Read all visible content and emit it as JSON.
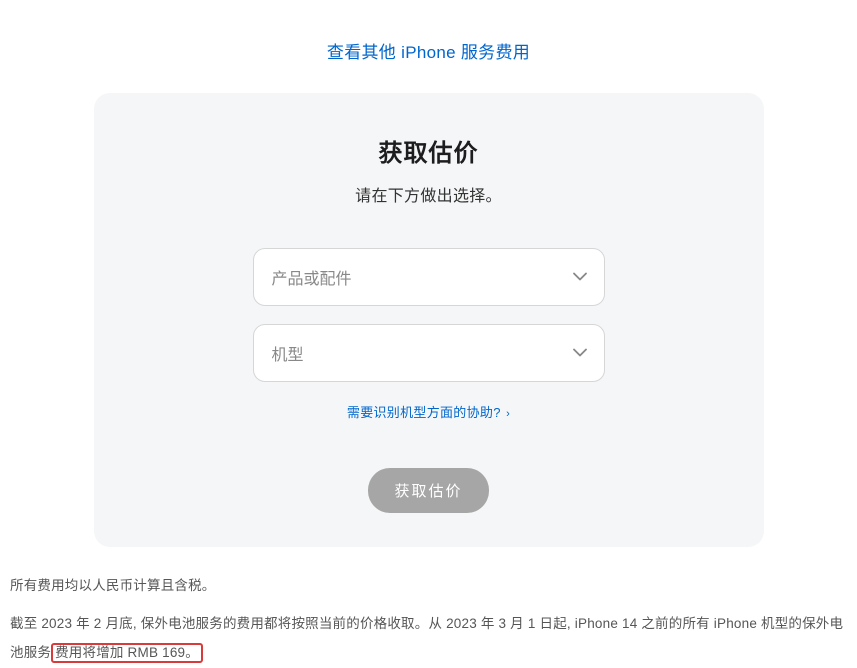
{
  "top_link": "查看其他 iPhone 服务费用",
  "card": {
    "title": "获取估价",
    "subtitle": "请在下方做出选择。",
    "select_product_placeholder": "产品或配件",
    "select_model_placeholder": "机型",
    "help_link": "需要识别机型方面的协助?",
    "submit": "获取估价"
  },
  "footer": {
    "note1": "所有费用均以人民币计算且含税。",
    "note2_part1": "截至 2023 年 2 月底, 保外电池服务的费用都将按照当前的价格收取。从 2023 年 3 月 1 日起, iPhone 14 之前的所有 iPhone 机型的保外电池服务",
    "note2_highlight": "费用将增加 RMB 169。"
  }
}
